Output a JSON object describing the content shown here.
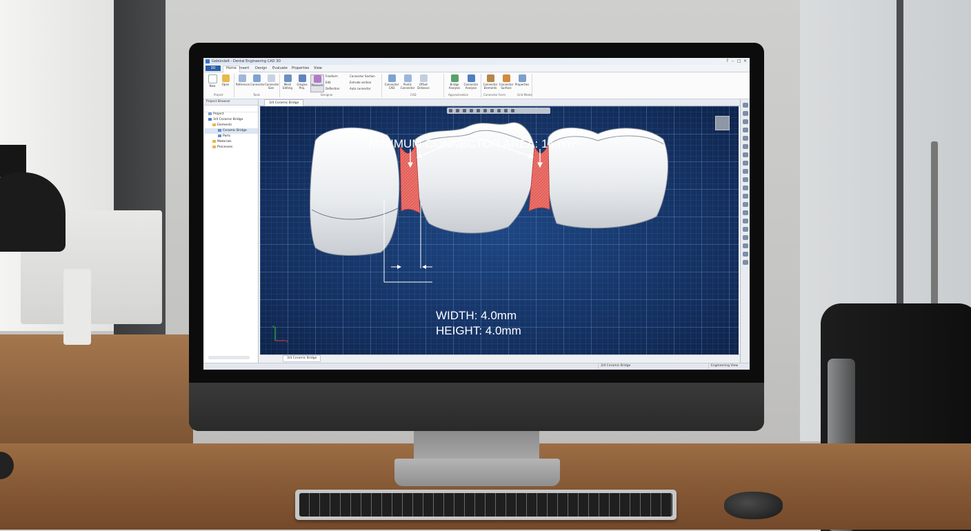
{
  "window": {
    "title": "Gebündelt - Dental Engineering CAD 3D"
  },
  "ribbon": {
    "file_tab": "3D",
    "tabs": [
      "Home",
      "Insert",
      "Design",
      "Evaluate",
      "Properties",
      "View"
    ],
    "active_tab": "Home",
    "buttons": [
      {
        "label": "New"
      },
      {
        "label": "Open"
      },
      {
        "label": "Reference"
      },
      {
        "label": "Connector"
      },
      {
        "label": "Connector Size"
      },
      {
        "label": "Mesh Editing"
      },
      {
        "label": "Gingiva Proj."
      },
      {
        "label": "Measure"
      },
      {
        "label": "Connector CAD"
      },
      {
        "label": "Pontic Connector"
      },
      {
        "label": "Offset Distance"
      },
      {
        "label": "Bridge Analysis"
      },
      {
        "label": "Connector Analysis"
      },
      {
        "label": "Connector Elements"
      },
      {
        "label": "Connector Surface"
      },
      {
        "label": "Properties"
      }
    ],
    "small_items": [
      "Freeform",
      "Edit",
      "Deflection",
      "Connector Section",
      "Extrude section",
      "Auto connector"
    ],
    "groups": [
      "Project",
      "Tools",
      "Designer",
      "CAD",
      "Approximation",
      "Connector Form",
      "Grid Meets"
    ]
  },
  "project_browser": {
    "title": "Project Browser",
    "tree": [
      {
        "label": "Project"
      },
      {
        "label": "3/4 Ceramic Bridge"
      },
      {
        "label": "Elements"
      },
      {
        "label": "Ceramic Bridge"
      },
      {
        "label": "Parts"
      },
      {
        "label": "Materials"
      },
      {
        "label": "Processes"
      }
    ]
  },
  "viewport": {
    "tab": "3/4 Ceramic Bridge",
    "annotation_title": "MINIMUM CONNECTOR AREA: 16mm²",
    "width_label": "WIDTH: 4.0mm",
    "height_label": "HEIGHT: 4.0mm",
    "bottom_tab": "3/4 Ceramic Bridge",
    "axis_labels": {
      "y": "Y",
      "x": "X"
    }
  },
  "status": {
    "document": "3/4 Ceramic Bridge",
    "mode": "Engineering View"
  },
  "colors": {
    "viewport_bg": "#15335f",
    "connector_fill": "#e05a55",
    "annotation_white": "#ffffff"
  }
}
